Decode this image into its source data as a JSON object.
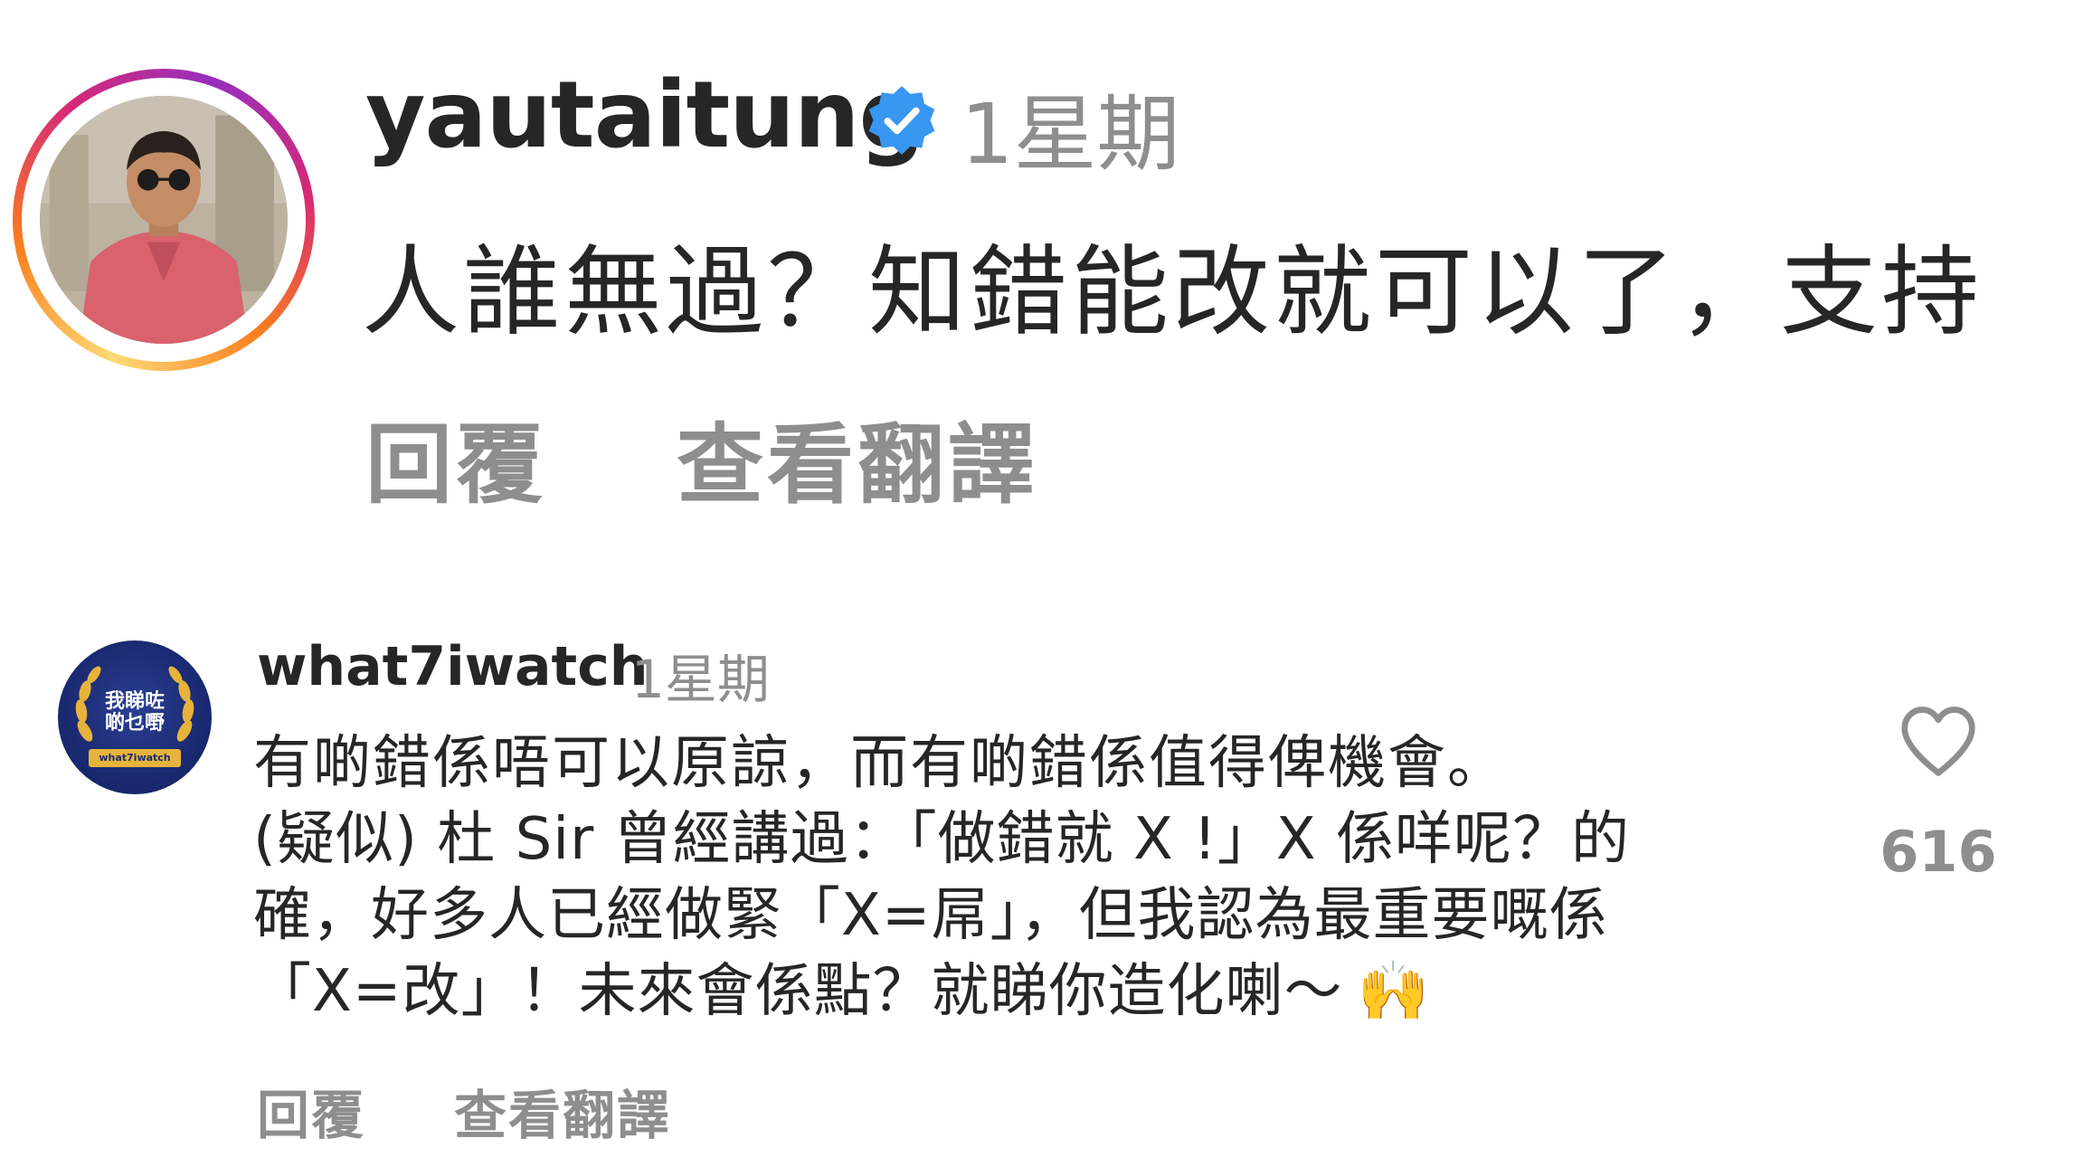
{
  "top_comment": {
    "username": "yautaitung",
    "verified": true,
    "time": "1星期",
    "text": "人誰無過？知錯能改就可以了，支持",
    "reply_label": "回覆",
    "translate_label": "查看翻譯"
  },
  "comment": {
    "username": "what7iwatch",
    "time": "1星期",
    "avatar_badge": {
      "line1": "我睇咗",
      "line2": "啲乜嘢",
      "ribbon": "what7iwatch"
    },
    "lines": [
      "有啲錯係唔可以原諒，而有啲錯係值得俾機會。",
      "(疑似) 杜 Sir 曾經講過：「做錯就 X !」X 係咩呢？的",
      "確，好多人已經做緊「X=屌」，但我認為最重要嘅係",
      "「X=改」！未來會係點？就睇你造化喇～"
    ],
    "emoji": "🙌",
    "reply_label": "回覆",
    "translate_label": "查看翻譯",
    "like_count": "616"
  },
  "colors": {
    "text_primary": "#262626",
    "text_secondary": "#8e8e8e",
    "verified_blue": "#3897f0"
  },
  "icons": {
    "verified": "verified-badge-icon",
    "like": "heart-outline-icon"
  }
}
